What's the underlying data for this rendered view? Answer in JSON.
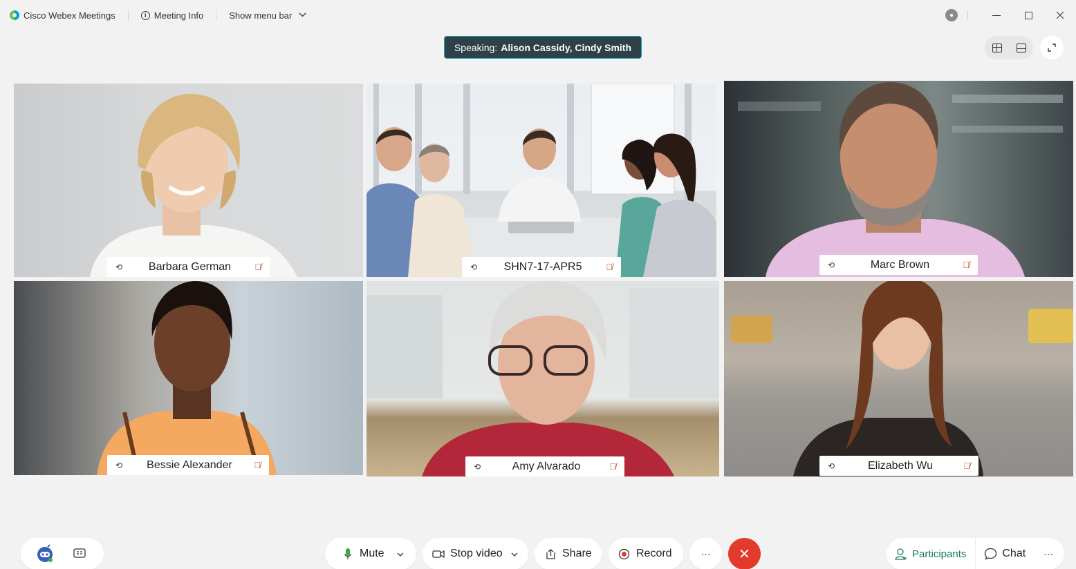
{
  "titlebar": {
    "app_name": "Cisco Webex Meetings",
    "meeting_info": "Meeting Info",
    "menu_bar": "Show menu bar"
  },
  "speaking": {
    "prefix": "Speaking:",
    "names": "Alison Cassidy, Cindy Smith"
  },
  "participants": [
    {
      "name": "Barbara German",
      "muted": true
    },
    {
      "name": "SHN7-17-APR5",
      "muted": true
    },
    {
      "name": "Marc Brown",
      "muted": true
    },
    {
      "name": "Bessie Alexander",
      "muted": true
    },
    {
      "name": "Amy Alvarado",
      "muted": true
    },
    {
      "name": "Elizabeth Wu",
      "muted": true
    }
  ],
  "controls": {
    "mute": "Mute",
    "stop_video": "Stop video",
    "share": "Share",
    "record": "Record",
    "more": "···",
    "end": "✕",
    "participants": "Participants",
    "chat": "Chat",
    "right_more": "···"
  },
  "colors": {
    "accent_teal": "#21a2b8",
    "end_red": "#e23b2c",
    "mic_green": "#3aa845",
    "participants_green": "#157a5f"
  }
}
